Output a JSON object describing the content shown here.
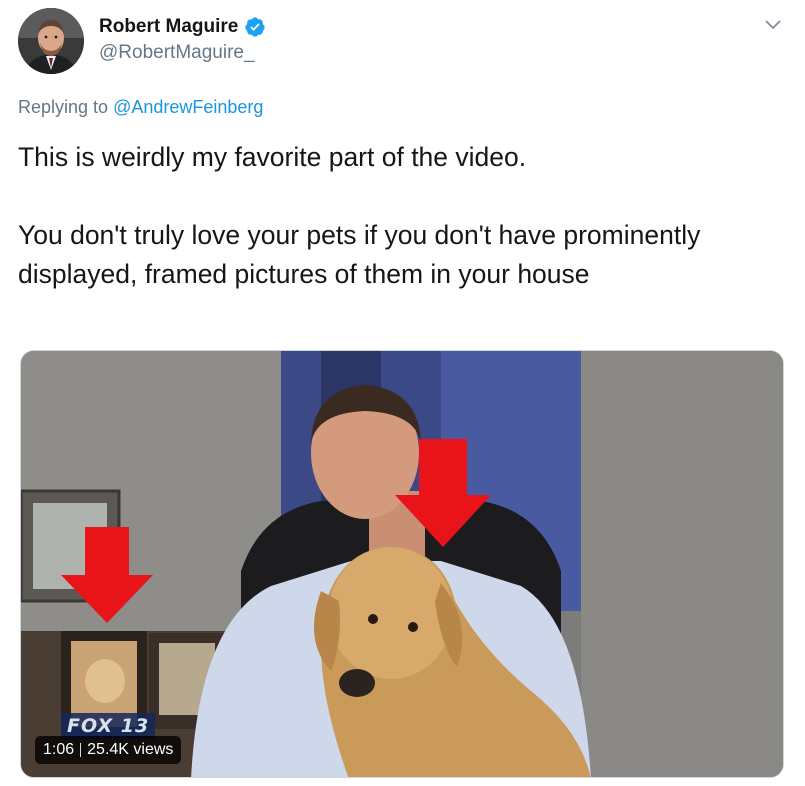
{
  "author": {
    "display_name": "Robert Maguire",
    "handle": "@RobertMaguire_",
    "verified": true,
    "avatar_icon": "avatar"
  },
  "reply": {
    "prefix": "Replying to",
    "target": "@AndrewFeinberg"
  },
  "tweet": {
    "paragraph_1": "This is weirdly my favorite part of the video.",
    "paragraph_2": "You don't truly love your pets if you don't have prominently displayed, framed pictures of them in your house"
  },
  "media": {
    "duration": "1:06",
    "views": "25.4K views",
    "station_logo_text": "FOX 13"
  },
  "icons": {
    "menu": "chevron-down-icon",
    "verified": "verified-badge-icon"
  },
  "colors": {
    "link": "#1b95e0",
    "verified": "#1da1f2",
    "secondary_text": "#657786",
    "arrow_red": "#e8141a"
  }
}
